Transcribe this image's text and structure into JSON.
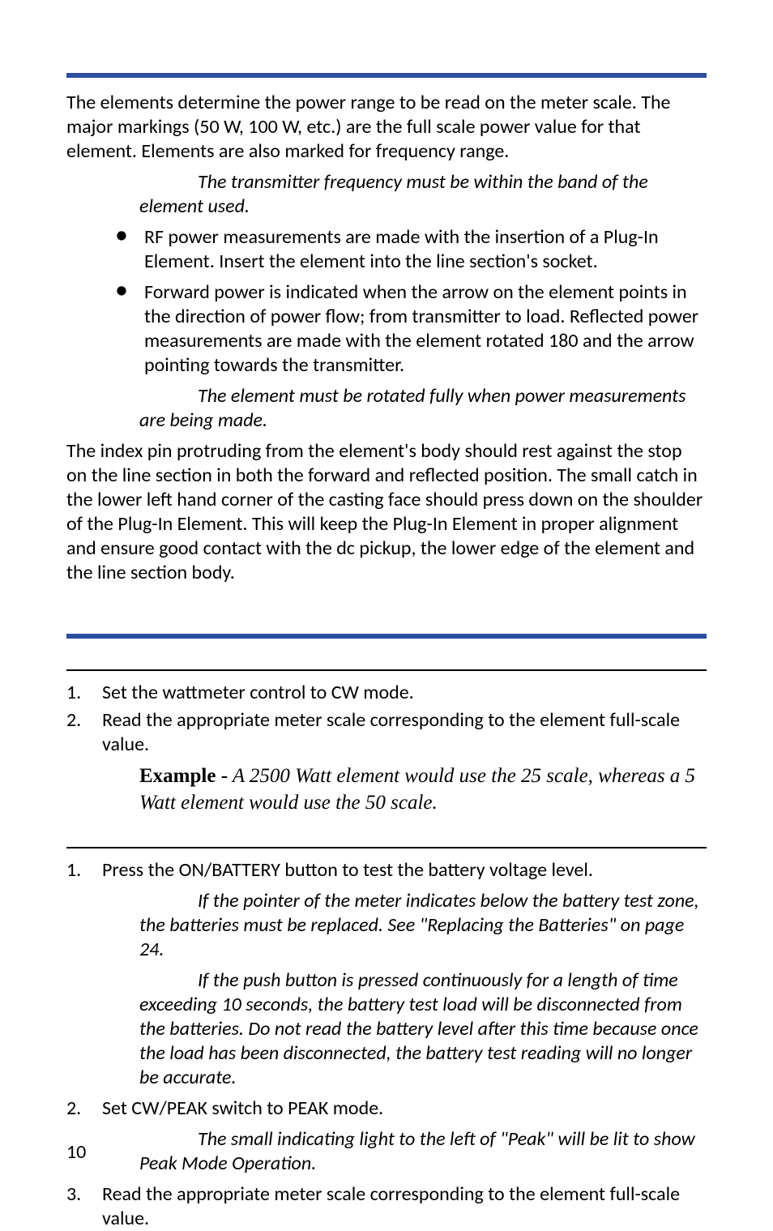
{
  "section1": {
    "p1": "The elements determine the power range to be read on the meter scale. The major markings (50 W, 100 W, etc.) are the full scale power value for that element. Elements are also marked for frequency range.",
    "note1": "The transmitter frequency must be within the band of the element used.",
    "bullets": [
      "RF power measurements are made with the insertion of a Plug-In Element. Insert the element into the line section's socket.",
      "Forward power is indicated when the arrow on the element points in the direction of power flow; from transmitter to load. Reflected power measurements are made with the element rotated 180 and the arrow pointing towards the transmitter."
    ],
    "note2": "The element must be rotated fully when power measurements are being made.",
    "p2": "The index pin protruding from the element's body should rest against the stop on the line section in both the forward and reflected position. The small catch in the lower left hand corner of the casting face should press down on the shoulder of the Plug-In Element. This will keep the Plug-In Element in proper alignment and ensure good contact with the dc pickup, the lower edge of the element and the line section body."
  },
  "section2": {
    "steps_a": [
      {
        "n": "1.",
        "t": "Set the wattmeter control to CW mode."
      },
      {
        "n": "2.",
        "t": "Read the appropriate meter scale corresponding to the element full-scale value."
      }
    ],
    "example_label": "Example -",
    "example_text": " A 2500 Watt element would use the 25 scale, whereas a 5 Watt element would use the 50 scale.",
    "steps_b": {
      "s1": {
        "n": "1.",
        "t": "Press the ON/BATTERY button to test the battery voltage level."
      },
      "note_b1": "If the pointer of the meter indicates below the battery test zone, the batteries must be replaced. See \"Replacing the Batteries\" on page 24.",
      "note_b2": "If the push button is pressed continuously for a length of time exceeding 10 seconds, the battery test load will be disconnected from the batteries.  Do not read the battery level after this time because once the load has been disconnected, the battery test reading will no longer be accurate.",
      "s2": {
        "n": "2.",
        "t": "Set CW/PEAK switch to PEAK mode."
      },
      "note_b3": "The small indicating light to the left of \"Peak\" will be lit to show Peak Mode Operation.",
      "s3": {
        "n": "3.",
        "t": "Read the appropriate meter scale corresponding to the element full-scale value."
      }
    }
  },
  "page_number": "10"
}
